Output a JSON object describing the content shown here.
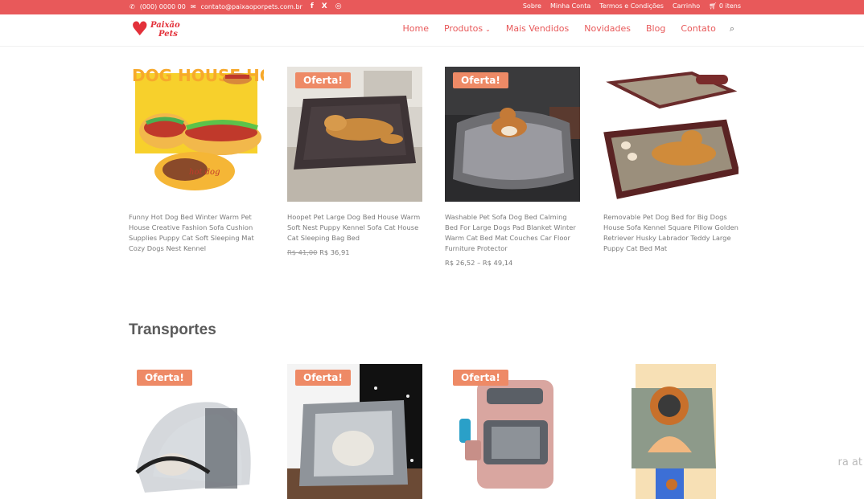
{
  "topbar": {
    "phone": "(000) 0000 00",
    "email": "contato@paixaoporpets.com.br",
    "social_facebook": "f",
    "social_x": "X",
    "social_instagram": "◎",
    "links": [
      "Sobre",
      "Minha Conta",
      "Termos e Condições",
      "Carrinho"
    ],
    "cart": "0 itens"
  },
  "header": {
    "logo_line1": "Paixão",
    "logo_line2": "Pets",
    "nav": [
      "Home",
      "Produtos",
      "Mais Vendidos",
      "Novidades",
      "Blog",
      "Contato"
    ]
  },
  "beds": [
    {
      "title": "Funny Hot Dog Bed Winter Warm Pet House Creative Fashion Sofa Cushion Supplies Puppy Cat Soft Sleeping Mat Cozy Dogs Nest Kennel",
      "badge": "",
      "image_text": "DOG HOUSE HOT DOG"
    },
    {
      "title": "Hoopet Pet Large Dog Bed House Warm Soft Nest Puppy Kennel Sofa Cat House Cat Sleeping Bag Bed",
      "badge": "Oferta!",
      "old_price": "R$ 41,00",
      "price": "R$ 36,91"
    },
    {
      "title": "Washable Pet Sofa Dog Bed Calming Bed For Large Dogs Pad Blanket Winter Warm Cat Bed Mat Couches Car Floor Furniture Protector",
      "badge": "Oferta!",
      "price_range": "R$ 26,52 – R$ 49,14"
    },
    {
      "title": "Removable Pet Dog Bed for Big Dogs House Sofa Kennel Square Pillow Golden Retriever Husky Labrador Teddy Large Puppy Cat Bed Mat",
      "badge": ""
    }
  ],
  "section_title": "Transportes",
  "transport": [
    {
      "badge": "Oferta!"
    },
    {
      "badge": "Oferta!"
    },
    {
      "badge": "Oferta!"
    },
    {
      "badge": ""
    }
  ],
  "chat_text": "ra at"
}
